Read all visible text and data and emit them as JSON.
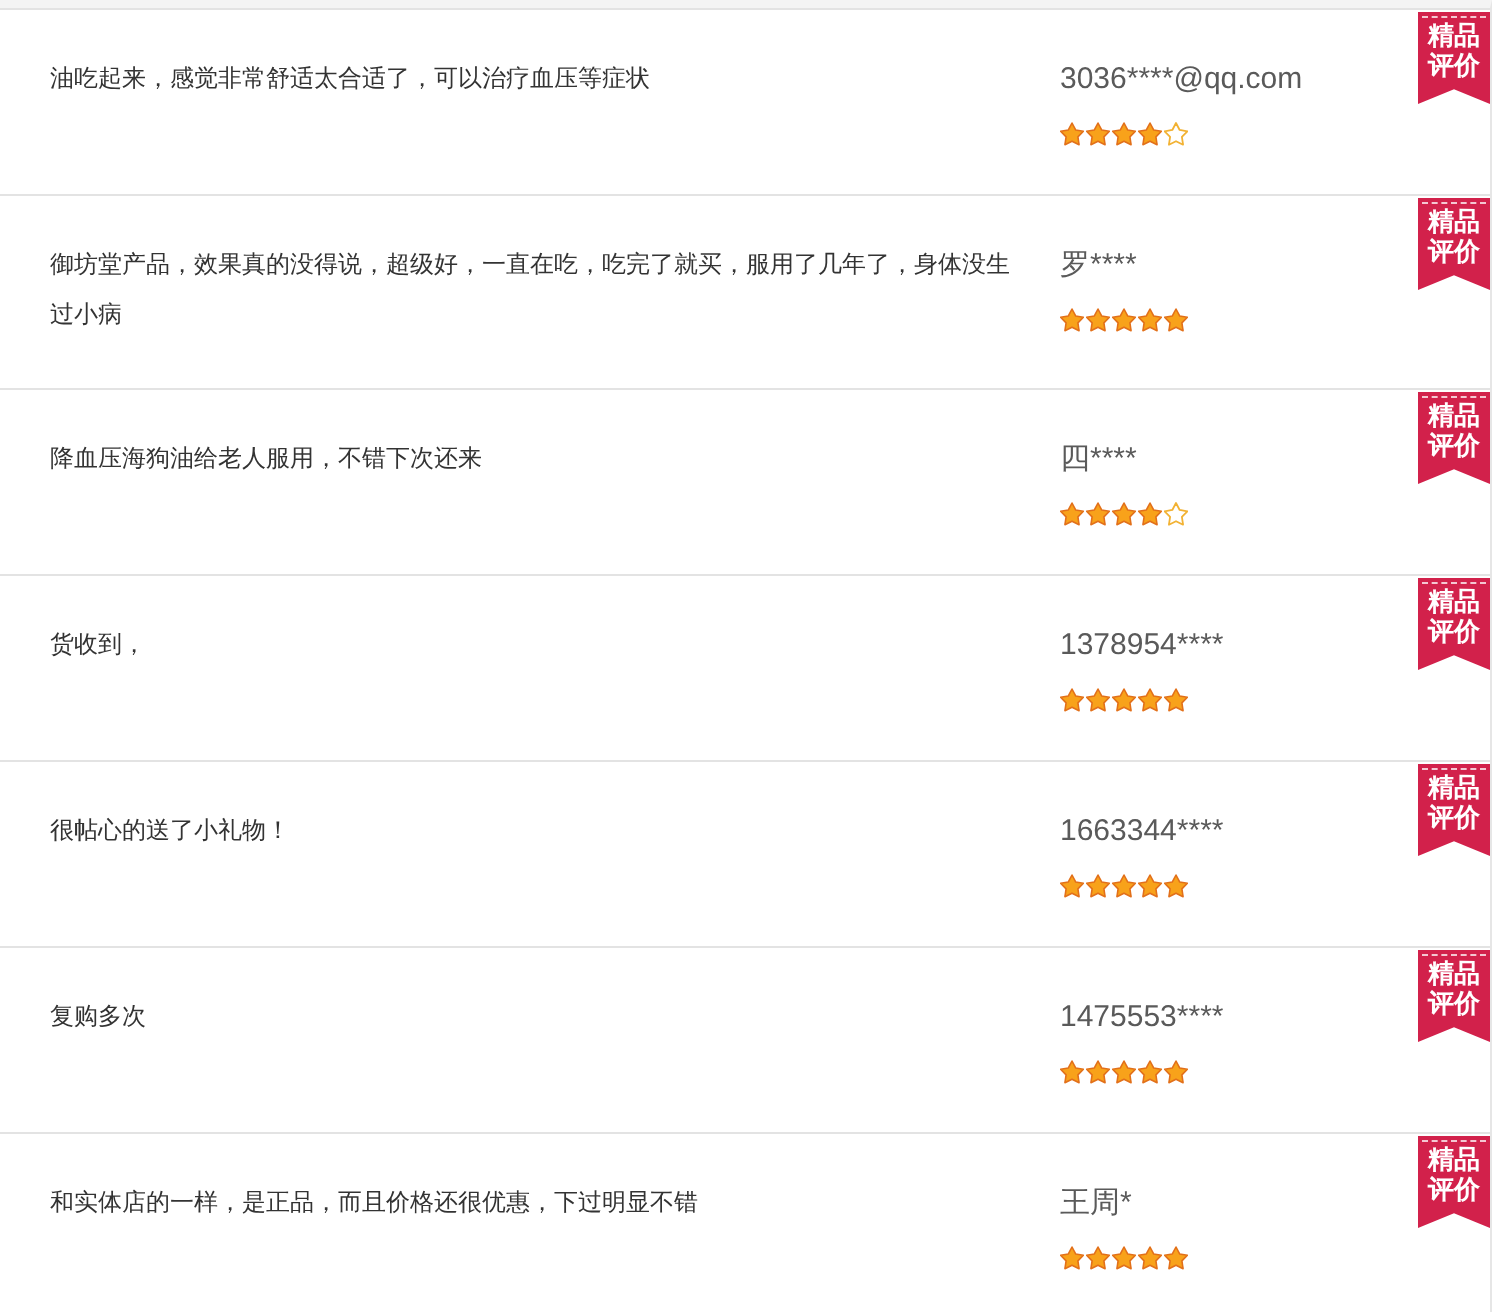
{
  "reviews": [
    {
      "text": "油吃起来，感觉非常舒适太合适了，可以治疗血压等症状",
      "user": "3036****@qq.com",
      "stars": 4,
      "badge": "精品评价"
    },
    {
      "text": "御坊堂产品，效果真的没得说，超级好，一直在吃，吃完了就买，服用了几年了，身体没生过小病",
      "user": "罗****",
      "stars": 5,
      "badge": "精品评价"
    },
    {
      "text": "降血压海狗油给老人服用，不错下次还来",
      "user": "四****",
      "stars": 4,
      "badge": "精品评价"
    },
    {
      "text": "货收到，",
      "user": "1378954****",
      "stars": 5,
      "badge": "精品评价"
    },
    {
      "text": "很帖心的送了小礼物！",
      "user": "1663344****",
      "stars": 5,
      "badge": "精品评价"
    },
    {
      "text": "复购多次",
      "user": "1475553****",
      "stars": 5,
      "badge": "精品评价"
    },
    {
      "text": "和实体店的一样，是正品，而且价格还很优惠，下过明显不错",
      "user": "王周*",
      "stars": 5,
      "badge": "精品评价"
    }
  ]
}
